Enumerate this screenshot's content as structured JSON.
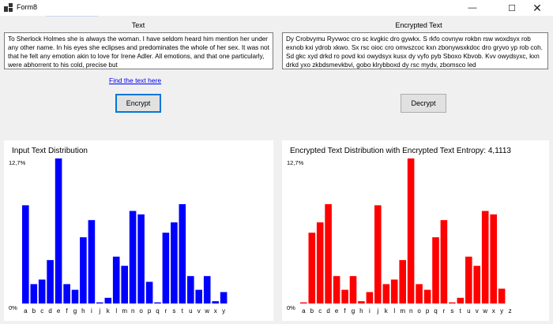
{
  "window": {
    "title": "Form8",
    "minimize": "—",
    "maximize": "☐",
    "close": "✕"
  },
  "labels": {
    "text": "Text",
    "encrypted": "Encrypted Text"
  },
  "input_text": "To Sherlock Holmes she is always the woman. I have seldom heard him mention her under any other name. In his eyes she eclipses and predominates the whole of her sex. It was not that he felt any emotion akin to love for Irene Adler. All emotions, and that one particularly, were abhorrent to his cold, precise but",
  "encrypted_text": "Dy Crobvymu Ryvwoc cro sc kvgkic dro gywkx. S rkfo covnyw rokbn rsw woxdsyx rob exnob kxi ydrob xkwo. Sx rsc oioc cro omvszcoc kxn zbonywsxkdoc dro gryvo yp rob coh. Sd gkc xyd drkd ro povd kxi owydsyx kusx dy vyfo pyb Sboxo Kbvob. Kvv owydsyxc, kxn drkd yxo zkbdsmevkbvi, gobo klrybboxd dy rsc mydv, zbomsco led",
  "link": "Find the text here",
  "buttons": {
    "encrypt": "Encrypt",
    "decrypt": "Decrypt"
  },
  "chart_data": [
    {
      "type": "bar",
      "title": "Input Text Distribution",
      "color": "#0000ff",
      "ymax_label": "12,7%",
      "ymin_label": "0%",
      "ylim": [
        0,
        12.7
      ],
      "categories": [
        "a",
        "b",
        "c",
        "d",
        "e",
        "f",
        "g",
        "h",
        "i",
        "j",
        "k",
        "l",
        "m",
        "n",
        "o",
        "p",
        "q",
        "r",
        "s",
        "t",
        "u",
        "v",
        "w",
        "x",
        "y"
      ],
      "values": [
        8.6,
        1.7,
        2.1,
        3.8,
        12.7,
        1.7,
        1.2,
        5.8,
        7.3,
        0.1,
        0.5,
        4.1,
        3.3,
        8.1,
        7.8,
        1.9,
        0.1,
        6.2,
        7.1,
        8.7,
        2.4,
        1.2,
        2.4,
        0.2,
        1.0
      ]
    },
    {
      "type": "bar",
      "title": "Encrypted Text Distribution with Encrypted Text Entropy: 4,1113",
      "color": "#ff0000",
      "ymax_label": "12,7%",
      "ymin_label": "0%",
      "ylim": [
        0,
        12.7
      ],
      "categories": [
        "a",
        "b",
        "c",
        "d",
        "e",
        "f",
        "g",
        "h",
        "i",
        "j",
        "k",
        "l",
        "m",
        "n",
        "o",
        "p",
        "q",
        "r",
        "s",
        "t",
        "u",
        "v",
        "w",
        "x",
        "y",
        "z"
      ],
      "values": [
        0.1,
        6.2,
        7.1,
        8.7,
        2.4,
        1.2,
        2.4,
        0.2,
        1.0,
        8.6,
        1.7,
        2.1,
        3.8,
        12.7,
        1.7,
        1.2,
        5.8,
        7.3,
        0.1,
        0.5,
        4.1,
        3.3,
        8.1,
        7.8,
        1.3
      ]
    }
  ]
}
